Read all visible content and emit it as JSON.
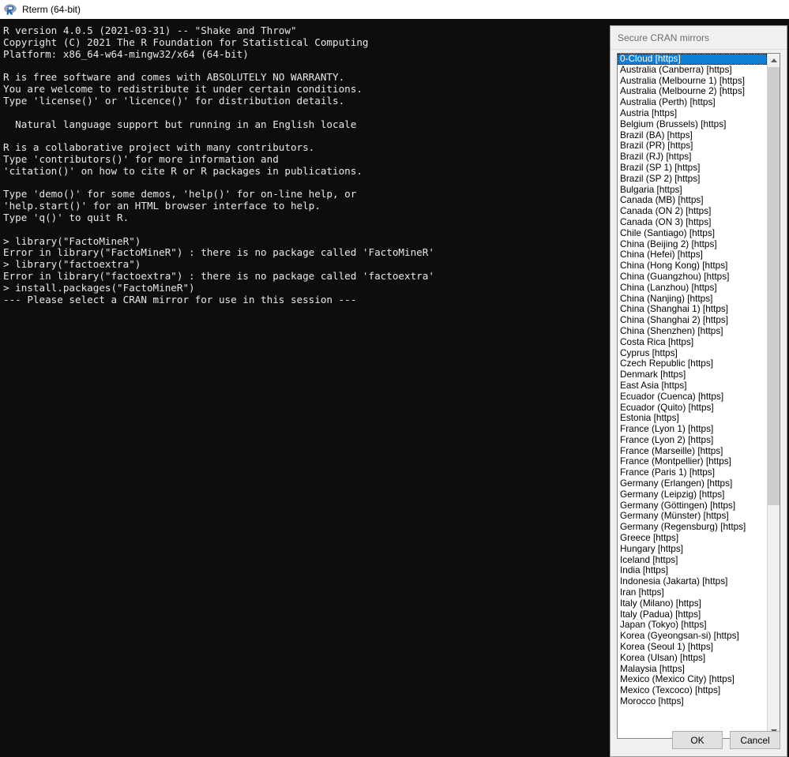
{
  "window": {
    "title": "Rterm (64-bit)",
    "icon": "r-logo-icon"
  },
  "console": {
    "text": "R version 4.0.5 (2021-03-31) -- \"Shake and Throw\"\nCopyright (C) 2021 The R Foundation for Statistical Computing\nPlatform: x86_64-w64-mingw32/x64 (64-bit)\n\nR is free software and comes with ABSOLUTELY NO WARRANTY.\nYou are welcome to redistribute it under certain conditions.\nType 'license()' or 'licence()' for distribution details.\n\n  Natural language support but running in an English locale\n\nR is a collaborative project with many contributors.\nType 'contributors()' for more information and\n'citation()' on how to cite R or R packages in publications.\n\nType 'demo()' for some demos, 'help()' for on-line help, or\n'help.start()' for an HTML browser interface to help.\nType 'q()' to quit R.\n\n> library(\"FactoMineR\")\nError in library(\"FactoMineR\") : there is no package called 'FactoMineR'\n> library(\"factoextra\")\nError in library(\"factoextra\") : there is no package called 'factoextra'\n> install.packages(\"FactoMineR\")\n--- Please select a CRAN mirror for use in this session ---"
  },
  "dialog": {
    "title": "Secure CRAN mirrors",
    "selected_index": 0,
    "mirrors": [
      "0-Cloud [https]",
      "Australia (Canberra) [https]",
      "Australia (Melbourne 1) [https]",
      "Australia (Melbourne 2) [https]",
      "Australia (Perth) [https]",
      "Austria [https]",
      "Belgium (Brussels) [https]",
      "Brazil (BA) [https]",
      "Brazil (PR) [https]",
      "Brazil (RJ) [https]",
      "Brazil (SP 1) [https]",
      "Brazil (SP 2) [https]",
      "Bulgaria [https]",
      "Canada (MB) [https]",
      "Canada (ON 2) [https]",
      "Canada (ON 3) [https]",
      "Chile (Santiago) [https]",
      "China (Beijing 2) [https]",
      "China (Hefei) [https]",
      "China (Hong Kong) [https]",
      "China (Guangzhou) [https]",
      "China (Lanzhou) [https]",
      "China (Nanjing) [https]",
      "China (Shanghai 1) [https]",
      "China (Shanghai 2) [https]",
      "China (Shenzhen) [https]",
      "Costa Rica [https]",
      "Cyprus [https]",
      "Czech Republic [https]",
      "Denmark [https]",
      "East Asia [https]",
      "Ecuador (Cuenca) [https]",
      "Ecuador (Quito) [https]",
      "Estonia [https]",
      "France (Lyon 1) [https]",
      "France (Lyon 2) [https]",
      "France (Marseille) [https]",
      "France (Montpellier) [https]",
      "France (Paris 1) [https]",
      "Germany (Erlangen) [https]",
      "Germany (Leipzig) [https]",
      "Germany (Göttingen) [https]",
      "Germany (Münster) [https]",
      "Germany (Regensburg) [https]",
      "Greece [https]",
      "Hungary [https]",
      "Iceland [https]",
      "India [https]",
      "Indonesia (Jakarta) [https]",
      "Iran [https]",
      "Italy (Milano) [https]",
      "Italy (Padua) [https]",
      "Japan (Tokyo) [https]",
      "Korea (Gyeongsan-si) [https]",
      "Korea (Seoul 1) [https]",
      "Korea (Ulsan) [https]",
      "Malaysia [https]",
      "Mexico (Mexico City) [https]",
      "Mexico (Texcoco) [https]",
      "Morocco [https]"
    ],
    "scrollbar": {
      "up_icon": "chevron-up-icon",
      "down_icon": "chevron-down-icon"
    },
    "buttons": {
      "ok": "OK",
      "cancel": "Cancel"
    }
  }
}
